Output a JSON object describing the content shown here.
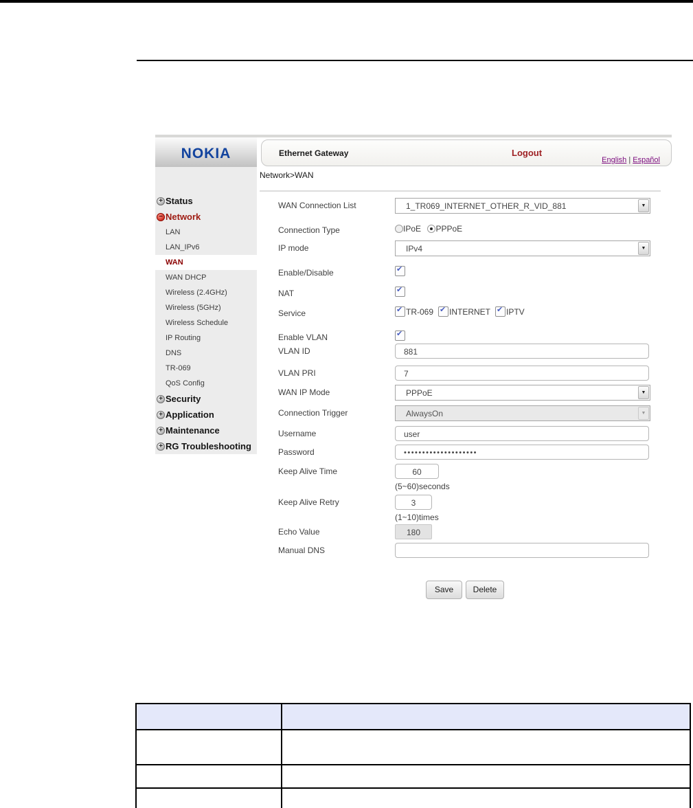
{
  "ui": {
    "logo_text": "NOKIA",
    "header": {
      "title": "Ethernet Gateway",
      "logout_label": "Logout",
      "lang_english": "English",
      "lang_separator": "|",
      "lang_espanol": "Español"
    },
    "breadcrumb": "Network>WAN",
    "sidebar": {
      "items": [
        {
          "label": "Status",
          "type": "group",
          "icon": "plus"
        },
        {
          "label": "Network",
          "type": "group",
          "icon": "minus",
          "active": true
        },
        {
          "label": "LAN",
          "type": "sub"
        },
        {
          "label": "LAN_IPv6",
          "type": "sub"
        },
        {
          "label": "WAN",
          "type": "sub",
          "selected": true
        },
        {
          "label": "WAN DHCP",
          "type": "sub"
        },
        {
          "label": "Wireless (2.4GHz)",
          "type": "sub"
        },
        {
          "label": "Wireless (5GHz)",
          "type": "sub"
        },
        {
          "label": "Wireless Schedule",
          "type": "sub"
        },
        {
          "label": "IP Routing",
          "type": "sub"
        },
        {
          "label": "DNS",
          "type": "sub"
        },
        {
          "label": "TR-069",
          "type": "sub"
        },
        {
          "label": "QoS Config",
          "type": "sub"
        },
        {
          "label": "Security",
          "type": "group",
          "icon": "plus"
        },
        {
          "label": "Application",
          "type": "group",
          "icon": "plus"
        },
        {
          "label": "Maintenance",
          "type": "group",
          "icon": "plus"
        },
        {
          "label": "RG Troubleshooting",
          "type": "group",
          "icon": "plus"
        }
      ]
    },
    "form": {
      "rows": [
        {
          "label": "WAN Connection List",
          "value": "1_TR069_INTERNET_OTHER_R_VID_881"
        },
        {
          "label": "Connection Type",
          "options": [
            {
              "label": "IPoE",
              "selected": false
            },
            {
              "label": "PPPoE",
              "selected": true
            }
          ]
        },
        {
          "label": "IP mode",
          "value": "IPv4"
        },
        {
          "label": "Enable/Disable",
          "checked": true
        },
        {
          "label": "NAT",
          "checked": true
        },
        {
          "label": "Service",
          "options": [
            {
              "label": "TR-069",
              "checked": true
            },
            {
              "label": "INTERNET",
              "checked": true
            },
            {
              "label": "IPTV",
              "checked": true
            }
          ]
        },
        {
          "label": "Enable VLAN",
          "checked": true
        },
        {
          "label": "VLAN ID",
          "value": "881"
        },
        {
          "label": "VLAN PRI",
          "value": "7"
        },
        {
          "label": "WAN IP Mode",
          "value": "PPPoE"
        },
        {
          "label": "Connection Trigger",
          "value": "AlwaysOn",
          "disabled": true
        },
        {
          "label": "Username",
          "value": "user"
        },
        {
          "label": "Password",
          "value": "••••••••••••••••••••"
        },
        {
          "label": "Keep Alive Time",
          "value": "60",
          "hint": "(5~60)seconds"
        },
        {
          "label": "Keep Alive Retry",
          "value": "3",
          "hint": "(1~10)times"
        },
        {
          "label": "Echo Value",
          "value": "180",
          "disabled": true
        },
        {
          "label": "Manual DNS",
          "value": ""
        }
      ],
      "buttons": [
        {
          "label": "Save"
        },
        {
          "label": "Delete"
        }
      ]
    }
  },
  "bottom_table": {
    "columns": [
      "",
      ""
    ],
    "rows": [
      [
        "",
        ""
      ],
      [
        "",
        ""
      ],
      [
        "",
        ""
      ]
    ]
  },
  "icons": {
    "plus": "+",
    "minus": "−",
    "check": "✔",
    "chevron_down": "▼"
  },
  "colors": {
    "nokia_blue": "#12439e",
    "logout_red": "#9e2023",
    "network_red": "#9e1b12",
    "wan_selected_red": "#8b0000",
    "link_purple": "#7d0f80",
    "table_header_bg": "#e4e8fa",
    "sidebar_gray": "#ececec"
  }
}
